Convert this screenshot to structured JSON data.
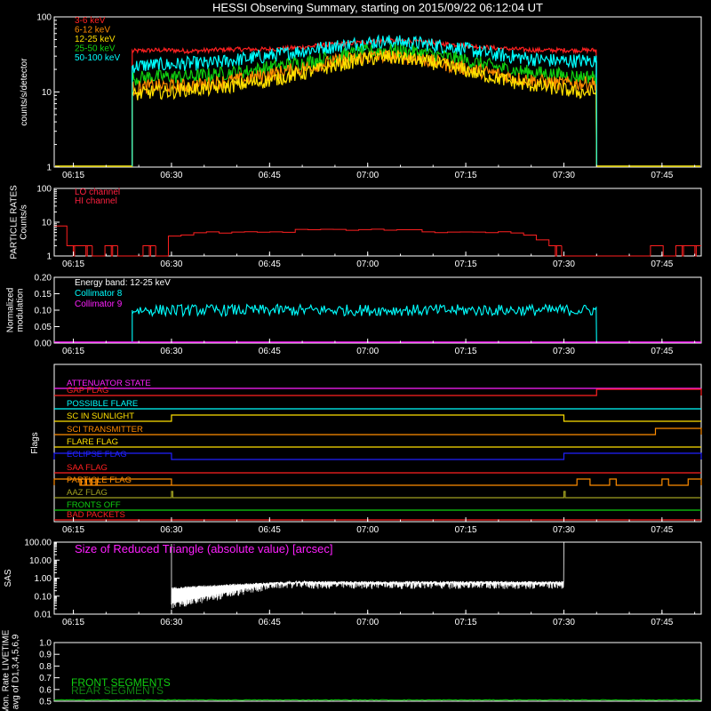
{
  "title": "HESSI Observing Summary, starting on 2015/09/22 06:12:04 UT",
  "time_ticks": [
    "06:15",
    "06:30",
    "06:45",
    "07:00",
    "07:15",
    "07:30",
    "07:45"
  ],
  "colors": {
    "red": "#ff2020",
    "orange": "#ff8c00",
    "yellow": "#ffe000",
    "green": "#10d010",
    "cyan": "#00ffff",
    "magenta": "#ff20ff",
    "blue": "#2020ff",
    "olive": "#a0a020",
    "white": "#ffffff"
  },
  "chart_data": [
    {
      "type": "line",
      "id": "count-rates",
      "ylabel": "counts/s/detector",
      "yscale": "log",
      "ylim": [
        1,
        100
      ],
      "ytick_labels": [
        "1",
        "10",
        "100"
      ],
      "legend_placement": "top-left",
      "series": [
        {
          "name": "3-6 keV",
          "color": "#ff2020",
          "start": "06:24",
          "end": "07:35",
          "levels": [
            35,
            36,
            36,
            35,
            36,
            37,
            37,
            37,
            38,
            40,
            42,
            44,
            46,
            48,
            48,
            46,
            44,
            42,
            40,
            38,
            37,
            36,
            36,
            36,
            36
          ]
        },
        {
          "name": "6-12 keV",
          "color": "#ff8c00",
          "start": "06:24",
          "end": "07:35",
          "levels": [
            11,
            12,
            12,
            12,
            13,
            14,
            15,
            17,
            19,
            21,
            24,
            27,
            29,
            30,
            29,
            27,
            24,
            21,
            19,
            17,
            15,
            14,
            13,
            13,
            13
          ]
        },
        {
          "name": "12-25 keV",
          "color": "#ffe000",
          "start": "06:24",
          "end": "07:35",
          "levels": [
            9,
            10,
            10,
            11,
            11,
            12,
            13,
            14,
            16,
            18,
            21,
            24,
            27,
            29,
            28,
            26,
            23,
            20,
            17,
            15,
            13,
            12,
            11,
            10,
            10
          ]
        },
        {
          "name": "25-50 keV",
          "color": "#10d010",
          "start": "06:24",
          "end": "07:35",
          "levels": [
            15,
            16,
            16,
            16,
            17,
            18,
            19,
            21,
            23,
            25,
            28,
            31,
            34,
            36,
            35,
            33,
            30,
            27,
            24,
            21,
            19,
            18,
            17,
            16,
            16
          ]
        },
        {
          "name": "50-100 keV",
          "color": "#00ffff",
          "start": "06:24",
          "end": "07:35",
          "levels": [
            22,
            23,
            23,
            24,
            24,
            26,
            28,
            30,
            33,
            36,
            39,
            42,
            45,
            47,
            46,
            44,
            41,
            38,
            34,
            31,
            29,
            27,
            26,
            26,
            26
          ]
        }
      ]
    },
    {
      "type": "line",
      "id": "particle-rates",
      "ylabel": "PARTICLE RATES\nCounts/s",
      "yscale": "log",
      "ylim": [
        1,
        100
      ],
      "ytick_labels": [
        "1",
        "10",
        "100"
      ],
      "legend_placement": "top-left",
      "series": [
        {
          "name": "LO channel",
          "color": "#ff2020"
        },
        {
          "name": "HI channel",
          "color": "#ff2020",
          "levels": [
            8,
            2,
            2,
            1,
            2,
            1,
            1,
            2,
            1,
            4,
            4,
            5,
            5,
            5,
            5,
            5,
            5,
            5,
            5,
            6,
            6,
            6,
            6,
            6,
            6,
            6,
            6,
            6,
            6,
            5,
            5,
            5,
            5,
            5,
            5,
            5,
            5,
            4,
            3,
            2,
            1,
            1,
            1,
            1,
            1,
            1,
            1,
            2,
            1,
            2,
            2
          ]
        }
      ]
    },
    {
      "type": "line",
      "id": "modulation",
      "ylabel": "Normalized\nmodulation",
      "ylim": [
        0.0,
        0.2
      ],
      "ytick_labels": [
        "0.00",
        "0.05",
        "0.10",
        "0.15",
        "0.20"
      ],
      "energy_band": "Energy band: 12-25 keV",
      "series": [
        {
          "name": "Collimator 8",
          "color": "#00ffff",
          "start": "06:24",
          "end": "07:35",
          "mean": 0.1
        },
        {
          "name": "Collimator 9",
          "color": "#ff20ff",
          "value": 0.0
        }
      ]
    },
    {
      "type": "line",
      "id": "flags",
      "ylabel": "Flags",
      "flags": [
        {
          "name": "ATTENUATOR STATE",
          "color": "#ff20ff",
          "state": "off"
        },
        {
          "name": "GAP FLAG",
          "color": "#ff2020",
          "state": "high after 07:35"
        },
        {
          "name": "POSSIBLE FLARE",
          "color": "#00ffff",
          "state": "off"
        },
        {
          "name": "SC IN SUNLIGHT",
          "color": "#ffe000",
          "state": "high 06:30-07:30"
        },
        {
          "name": "SCI TRANSMITTER",
          "color": "#ff8c00",
          "state": "high after 07:44"
        },
        {
          "name": "FLARE FLAG",
          "color": "#ffe000",
          "state": "off"
        },
        {
          "name": "ECLIPSE FLAG",
          "color": "#2020ff",
          "state": "high before 06:30 and after 07:30"
        },
        {
          "name": "SAA FLAG",
          "color": "#ff2020",
          "state": "off"
        },
        {
          "name": "PARTICLE FLAG",
          "color": "#ff8c00",
          "state": "intermittent"
        },
        {
          "name": "AAZ FLAG",
          "color": "#a0a020",
          "state": "short pulses"
        },
        {
          "name": "FRONTS OFF",
          "color": "#10d010",
          "state": "off"
        },
        {
          "name": "BAD PACKETS",
          "color": "#ff2020",
          "state": "off"
        }
      ]
    },
    {
      "type": "line",
      "id": "sas",
      "ylabel": "SAS",
      "yscale": "log",
      "ylim": [
        0.01,
        100
      ],
      "ytick_labels": [
        "0.01",
        "0.10",
        "1.00",
        "10.00",
        "100.00"
      ],
      "annotation": "Size of Reduced Triangle (absolute value) [arcsec]",
      "series": [
        {
          "name": "SAS triangle",
          "color": "#ffffff",
          "start": "06:30",
          "end": "07:30"
        }
      ]
    },
    {
      "type": "line",
      "id": "livetime",
      "ylabel": "Mon. Rate LIVETIME\navg of D1,3,4,5,6,9",
      "ylim": [
        0.5,
        1.0
      ],
      "ytick_labels": [
        "0.5",
        "0.6",
        "0.7",
        "0.8",
        "0.9",
        "1.0"
      ],
      "series": [
        {
          "name": "FRONT SEGMENTS",
          "color": "#10d010"
        },
        {
          "name": "REAR SEGMENTS",
          "color": "#108010"
        }
      ]
    }
  ]
}
